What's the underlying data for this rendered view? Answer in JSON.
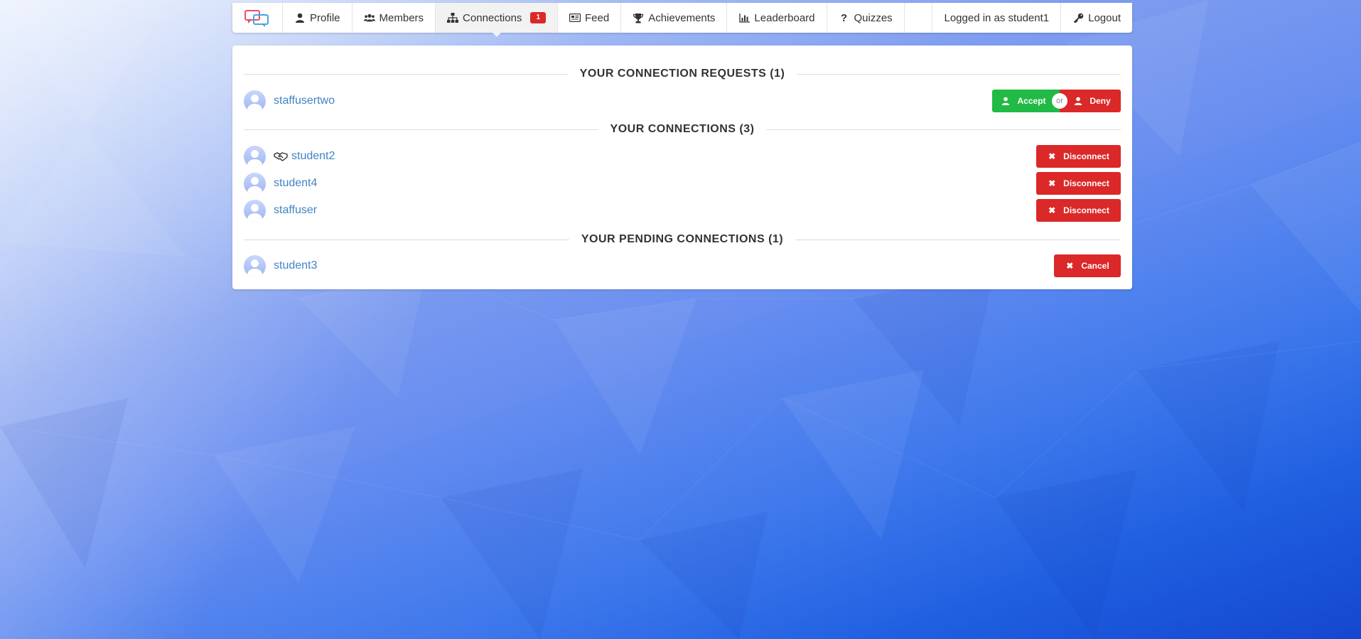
{
  "navbar": {
    "logo_icon": "speech-bubbles-logo",
    "items": [
      {
        "icon": "user-icon",
        "label": "Profile"
      },
      {
        "icon": "users-icon",
        "label": "Members"
      },
      {
        "icon": "sitemap-icon",
        "label": "Connections",
        "badge": "1",
        "active": true
      },
      {
        "icon": "newspaper-icon",
        "label": "Feed"
      },
      {
        "icon": "trophy-icon",
        "label": "Achievements"
      },
      {
        "icon": "bar-chart-icon",
        "label": "Leaderboard"
      },
      {
        "icon": "question-icon",
        "label": "Quizzes"
      }
    ],
    "logged_in_text": "Logged in as student1",
    "logout_label": "Logout"
  },
  "connection_requests": {
    "title": "YOUR CONNECTION REQUESTS (1)",
    "items": [
      {
        "username": "staffusertwo",
        "accept_label": "Accept",
        "or_label": "or",
        "deny_label": "Deny"
      }
    ]
  },
  "connections": {
    "title": "YOUR CONNECTIONS (3)",
    "items": [
      {
        "username": "student2",
        "icon": "handshake-icon",
        "action_label": "Disconnect"
      },
      {
        "username": "student4",
        "action_label": "Disconnect"
      },
      {
        "username": "staffuser",
        "action_label": "Disconnect"
      }
    ]
  },
  "pending": {
    "title": "YOUR PENDING CONNECTIONS (1)",
    "items": [
      {
        "username": "student3",
        "action_label": "Cancel"
      }
    ]
  },
  "colors": {
    "accent_link": "#4183c4",
    "green": "#21ba45",
    "red": "#db2828"
  }
}
